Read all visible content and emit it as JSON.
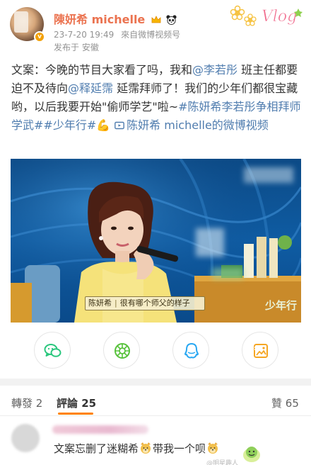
{
  "header": {
    "username": "陳妍希 michelle",
    "timestamp": "23-7-20 19:49",
    "source_prefix": "來自",
    "source": "微博视频号",
    "location": "发布于 安徽",
    "badge_text": "Vlog"
  },
  "post": {
    "t1": "文案：今晚的节目大家看了吗，我和",
    "m1": "@李若彤",
    "t2": " 班主任都要迫不及待向",
    "m2": "@释延霈",
    "t3": " 延霈拜师了！我们的少年们都很宝藏哟，以后我要开始\"偷师学艺\"啦~",
    "tag1": "#陈妍希李若彤争相拜师学武#",
    "tag2": "#少年行#",
    "emoji": "💪",
    "video_link_icon": "video-icon",
    "video_link": "陈妍希 michelle的微博视频"
  },
  "video": {
    "caption_name": "陈妍希",
    "caption_text": "很有哪个师父的样子",
    "watermark": "少年行"
  },
  "actions": [
    {
      "name": "chat-icon",
      "color": "#2bc77e"
    },
    {
      "name": "moments-icon",
      "color": "#57c23b"
    },
    {
      "name": "qq-icon",
      "color": "#2aa8f2"
    },
    {
      "name": "image-share-icon",
      "color": "#f5a623"
    }
  ],
  "tabs": {
    "repost_label": "轉發",
    "repost_count": "2",
    "comment_label": "評論",
    "comment_count": "25",
    "like_label": "贊",
    "like_count": "65",
    "accent": "#ff8200"
  },
  "comment": {
    "text1": "文案忘删了迷糊希",
    "text2": "带我一个呗",
    "watermark": "@明星趣人"
  },
  "colors": {
    "username": "#eb7350",
    "link": "#507daf",
    "meta": "#939393"
  }
}
